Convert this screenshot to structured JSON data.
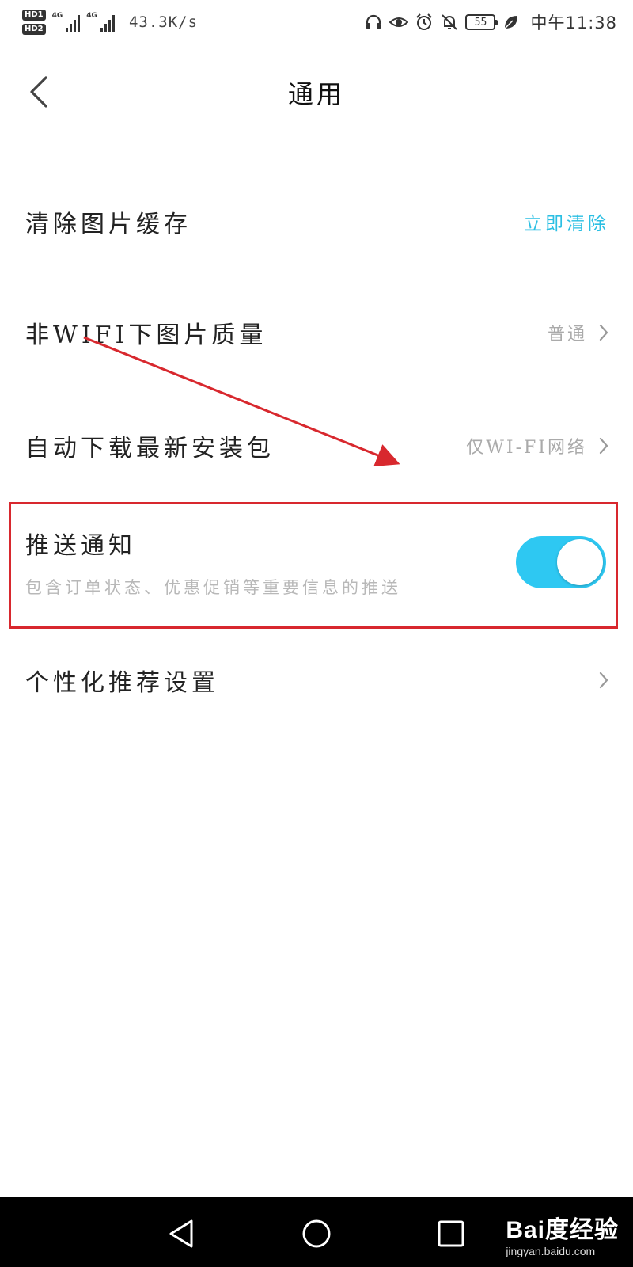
{
  "status_bar": {
    "hd1": "HD1",
    "hd2": "HD2",
    "sig1_label": "4G",
    "sig2_label": "4G",
    "net_speed": "43.3K/s",
    "battery": "55",
    "clock": "中午11:38"
  },
  "header": {
    "title": "通用"
  },
  "settings": {
    "clear_cache": {
      "label": "清除图片缓存",
      "action": "立即清除"
    },
    "image_quality": {
      "label": "非WIFI下图片质量",
      "value": "普通"
    },
    "auto_download": {
      "label": "自动下载最新安装包",
      "value": "仅WI-FI网络"
    },
    "push_notification": {
      "label": "推送通知",
      "description": "包含订单状态、优惠促销等重要信息的推送",
      "enabled": true
    },
    "personalized": {
      "label": "个性化推荐设置"
    }
  },
  "watermark": {
    "brand": "Bai度经验",
    "url": "jingyan.baidu.com"
  },
  "colors": {
    "accent": "#2bbfe3",
    "toggle_on": "#2ec8f2",
    "annotation": "#d8282e"
  }
}
